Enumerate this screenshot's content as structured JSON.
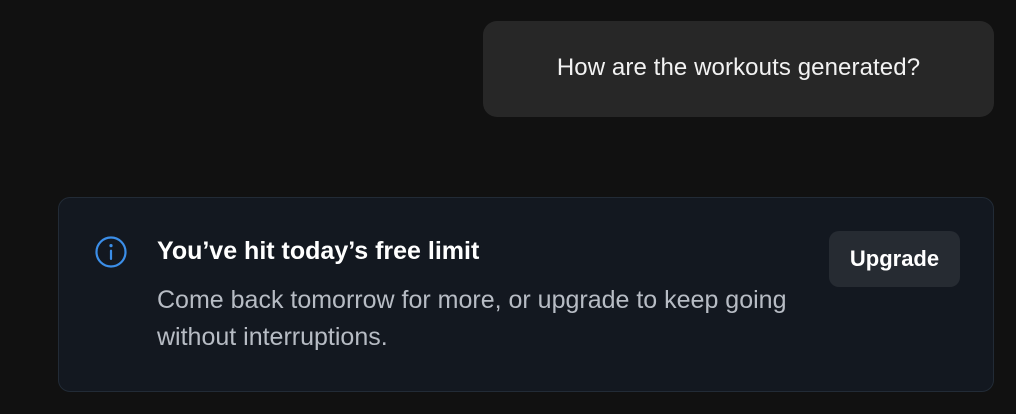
{
  "chat": {
    "user_message": "How are the workouts generated?"
  },
  "limit_notice": {
    "icon": "info-icon",
    "title": "You’ve hit today’s free limit",
    "message": "Come back tomorrow for more, or upgrade to keep going without interruptions.",
    "upgrade_label": "Upgrade"
  },
  "colors": {
    "background": "#111111",
    "user_bubble": "#272727",
    "card_background": "#131820",
    "card_border": "#222b36",
    "info_accent": "#3b8ee8",
    "button_background": "#262b32",
    "secondary_text": "#b7bcc4"
  }
}
